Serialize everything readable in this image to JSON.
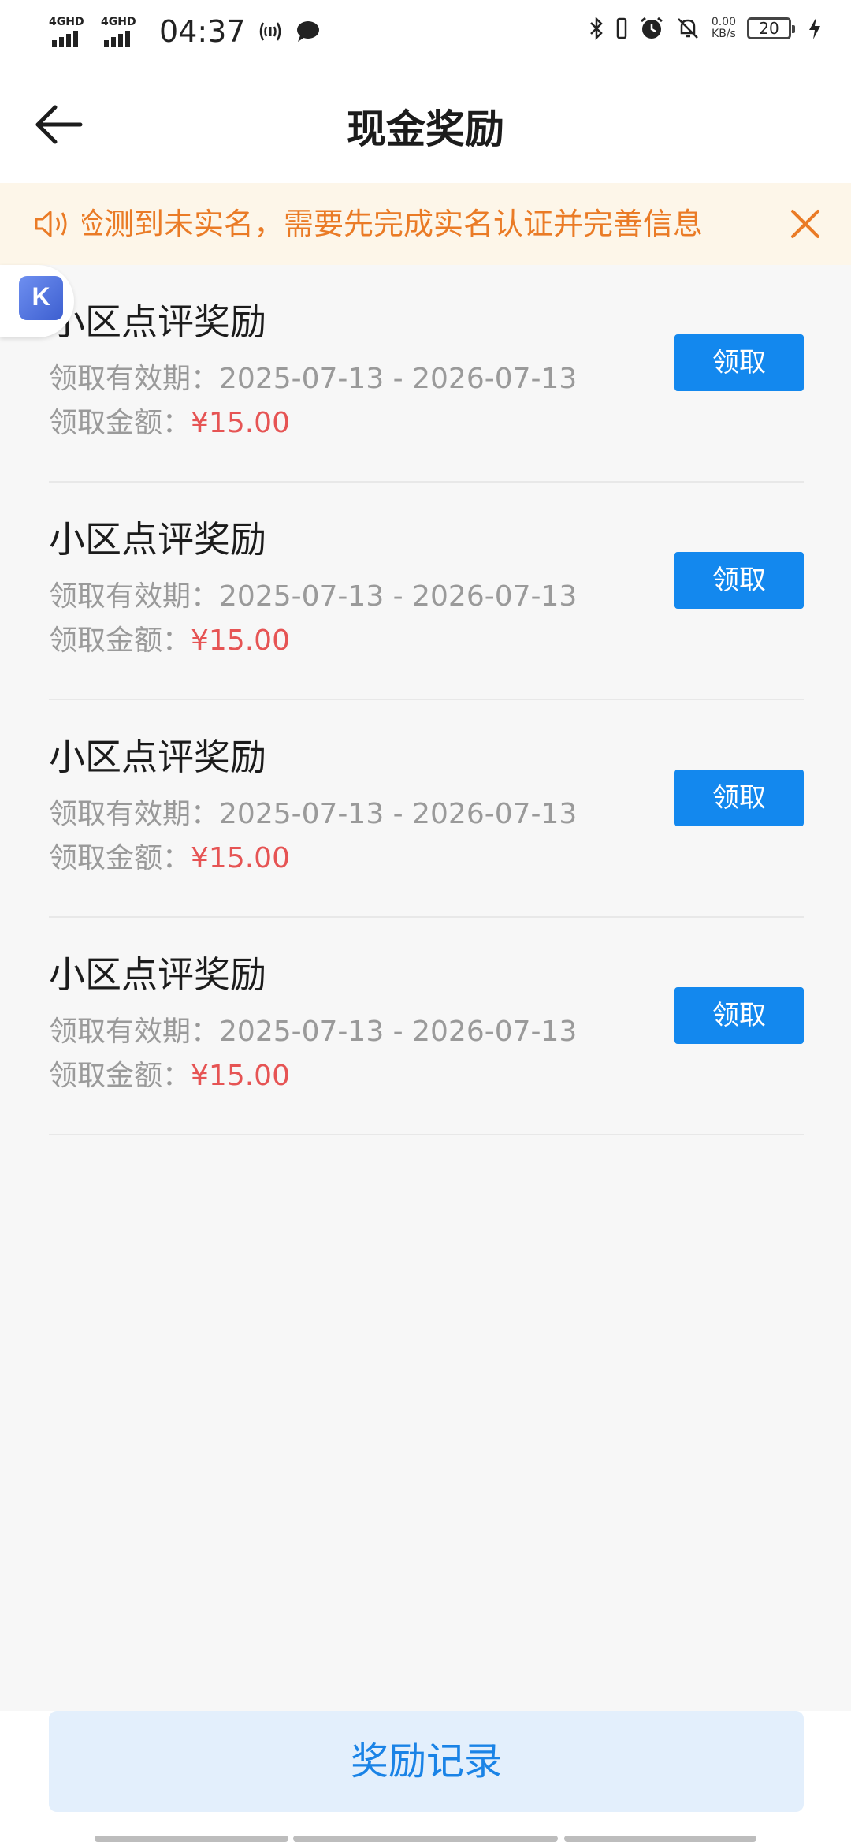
{
  "status_bar": {
    "signal_1_label": "4GHD",
    "signal_2_label": "4GHD",
    "time": "04:37",
    "net_speed_value": "0.00",
    "net_speed_unit": "KB/s",
    "battery": "20",
    "icons": [
      "hotspot-icon",
      "message-bubble-icon",
      "bluetooth-icon",
      "vibrate-icon",
      "alarm-icon",
      "mute-bell-icon",
      "charging-icon"
    ]
  },
  "header": {
    "title": "现金奖励"
  },
  "notice": {
    "text": "检测到未实名，需要先完成实名认证并完善信息",
    "color": "#ea7b26",
    "background": "#fdf6e9"
  },
  "float_badge": {
    "logo_letter": "K"
  },
  "rewards": [
    {
      "title": "小区点评奖励",
      "period_label": "领取有效期：",
      "period": "2025-07-13 - 2026-07-13",
      "amount_label": "领取金额：",
      "amount": "¥15.00",
      "button": "领取"
    },
    {
      "title": "小区点评奖励",
      "period_label": "领取有效期：",
      "period": "2025-07-13 - 2026-07-13",
      "amount_label": "领取金额：",
      "amount": "¥15.00",
      "button": "领取"
    },
    {
      "title": "小区点评奖励",
      "period_label": "领取有效期：",
      "period": "2025-07-13 - 2026-07-13",
      "amount_label": "领取金额：",
      "amount": "¥15.00",
      "button": "领取"
    },
    {
      "title": "小区点评奖励",
      "period_label": "领取有效期：",
      "period": "2025-07-13 - 2026-07-13",
      "amount_label": "领取金额：",
      "amount": "¥15.00",
      "button": "领取"
    }
  ],
  "bottom": {
    "records_button": "奖励记录"
  },
  "colors": {
    "primary": "#1388ee",
    "amount": "#e65454",
    "records_bg": "#e3effc",
    "records_text": "#1a83e6"
  }
}
